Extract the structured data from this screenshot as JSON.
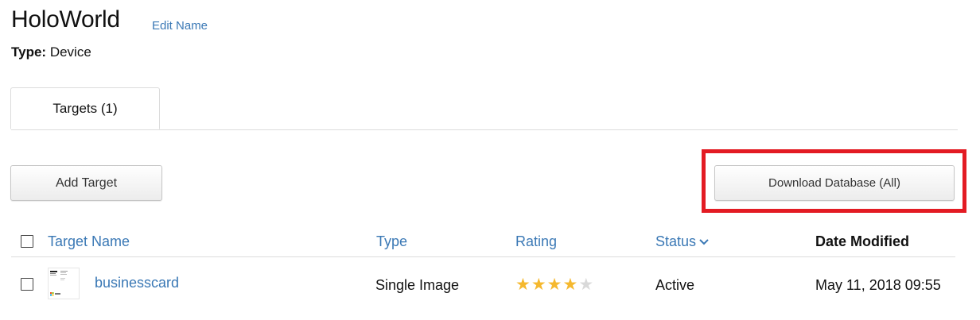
{
  "header": {
    "title": "HoloWorld",
    "edit_link": "Edit Name",
    "type_label": "Type:",
    "type_value": "Device"
  },
  "tabs": [
    {
      "label": "Targets (1)"
    }
  ],
  "toolbar": {
    "add_target_label": "Add Target",
    "download_label": "Download Database (All)"
  },
  "table": {
    "columns": {
      "name": "Target Name",
      "type": "Type",
      "rating": "Rating",
      "status": "Status",
      "date": "Date Modified"
    },
    "rows": [
      {
        "name": "businesscard",
        "type": "Single Image",
        "rating": 4,
        "rating_max": 5,
        "status": "Active",
        "date": "May 11, 2018 09:55"
      }
    ]
  },
  "colors": {
    "link": "#3a78b5",
    "star_filled": "#f5b82e",
    "star_empty": "#d9d9d9",
    "highlight": "#e31b23"
  },
  "icons": {
    "status_sort": "chevron-down-icon",
    "rating_star": "star-icon"
  }
}
